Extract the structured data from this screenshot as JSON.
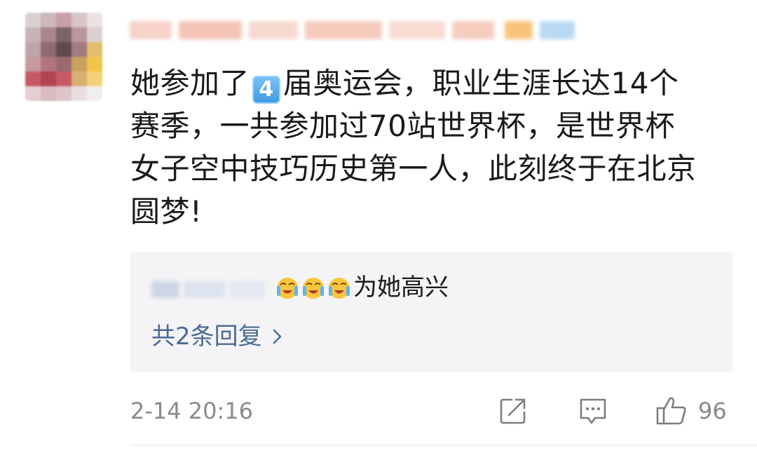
{
  "comment": {
    "text_lines": {
      "line1_before": "她参加了",
      "line1_keycap": "4",
      "line1_after": "届奥运会，职业生涯长达14个",
      "line2": "赛季，一共参加过70站世界杯，是世界杯",
      "line3": "女子空中技巧历史第一人，此刻终于在北京",
      "line4": "圆梦!"
    },
    "time": "2-14 20:16",
    "like_count": "96",
    "icons": [
      "share-icon",
      "comment-icon",
      "like-icon"
    ]
  },
  "reply": {
    "emoji": "crying-face-emoji",
    "emoji_count": 3,
    "text": "为她高兴",
    "more_label": "共2条回复",
    "more_icon": "chevron-right-icon"
  },
  "colors": {
    "link": "#4a6b95",
    "meta": "#8a8a8a",
    "text": "#1a1a1a",
    "reply_bg": "#f4f4f6",
    "keycap": "#3d98e0"
  }
}
